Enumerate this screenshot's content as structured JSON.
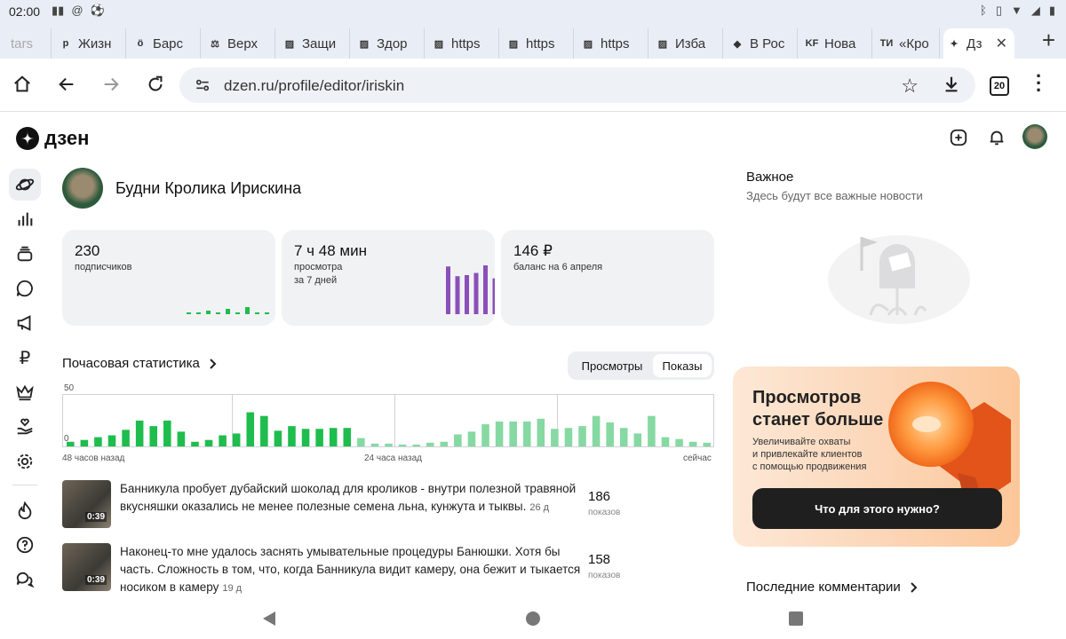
{
  "status_bar": {
    "time": "02:00"
  },
  "tabs": [
    {
      "label": "tars",
      "fav": ""
    },
    {
      "label": "Жизн",
      "fav": "р"
    },
    {
      "label": "Барс",
      "fav": "ö"
    },
    {
      "label": "Верх",
      "fav": "⚖"
    },
    {
      "label": "Защи",
      "fav": "▨"
    },
    {
      "label": "Здор",
      "fav": "▨"
    },
    {
      "label": "https",
      "fav": "▨"
    },
    {
      "label": "https",
      "fav": "▨"
    },
    {
      "label": "https",
      "fav": "▨"
    },
    {
      "label": "Изба",
      "fav": "▨"
    },
    {
      "label": "В Рос",
      "fav": "◆"
    },
    {
      "label": "Нова",
      "fav": "KF"
    },
    {
      "label": "«Кро",
      "fav": "ТИ"
    },
    {
      "label": "Дз",
      "fav": "✦"
    }
  ],
  "toolbar": {
    "url": "dzen.ru/profile/editor/iriskin",
    "tab_count": "20"
  },
  "logo": {
    "text": "дзен"
  },
  "channel": {
    "name": "Будни Кролика Ирискина"
  },
  "stats": [
    {
      "value": "230",
      "label": "подписчиков"
    },
    {
      "value": "7 ч 48 мин",
      "label": "просмотра\nза 7 дней"
    },
    {
      "value": "146 ₽",
      "label": "баланс на 6 апреля"
    }
  ],
  "spark_subscribers": [
    1,
    1,
    2,
    1,
    3,
    1,
    4,
    1,
    1
  ],
  "spark_views": [
    0,
    0,
    0,
    0,
    0,
    0,
    88,
    70,
    72,
    76,
    90,
    66,
    4
  ],
  "hourly": {
    "title": "Почасовая статистика",
    "toggle": [
      "Просмотры",
      "Показы"
    ],
    "active_toggle": 1,
    "y_max_label": "50",
    "y_min_label": "0",
    "x_labels": [
      "48 часов назад",
      "24 часа назад",
      "сейчас"
    ],
    "values_dark": [
      5,
      7,
      10,
      12,
      18,
      28,
      22,
      28,
      16,
      5,
      7,
      12,
      14,
      37,
      33,
      17,
      22,
      19,
      19,
      20,
      20
    ],
    "values_light": [
      9,
      3,
      3,
      2,
      2,
      4,
      5,
      13,
      16,
      24,
      27,
      27,
      27,
      30,
      19,
      20,
      22,
      33,
      26,
      20,
      14,
      33,
      10,
      8,
      5,
      4
    ]
  },
  "videos": [
    {
      "title": "Банникула пробует дубайский шоколад для кроликов - внутри полезной травяной вкусняшки оказались не менее полезные семена льна, кунжута и тыквы.",
      "age": "26 д",
      "duration": "0:39",
      "count": "186",
      "count_label": "показов"
    },
    {
      "title": "Наконец-то мне удалось заснять умывательные процедуры Банюшки. Хотя бы часть. Сложность в том, что, когда Банникула видит камеру, она бежит и тыкается носиком в камеру",
      "age": "19 д",
      "duration": "0:39",
      "count": "158",
      "count_label": "показов"
    }
  ],
  "important": {
    "title": "Важное",
    "subtitle": "Здесь будут все важные новости"
  },
  "promo": {
    "title": "Просмотров\nстанет больше",
    "text": "Увеличивайте охваты\nи привлекайте клиентов\nс помощью продвижения",
    "button": "Что для этого нужно?"
  },
  "comments": {
    "title": "Последние комментарии"
  },
  "colors": {
    "green_dark": "#1fbd4d",
    "green_light": "#86d9a2",
    "purple": "#8a4fb8",
    "card_bg": "#f1f2f4"
  }
}
